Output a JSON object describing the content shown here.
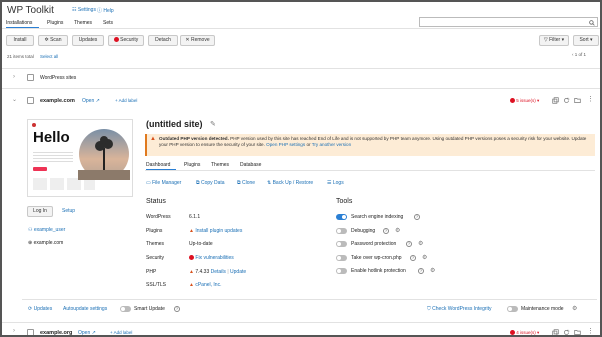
{
  "header": {
    "title": "WP Toolkit",
    "settings_label": "Settings",
    "help_label": "Help"
  },
  "tabs": [
    "Installations",
    "Plugins",
    "Themes",
    "Sets"
  ],
  "toolbar": {
    "install": "Install",
    "scan": "Scan",
    "updates": "Updates",
    "security": "Security",
    "detach": "Detach",
    "remove": "Remove",
    "filter": "Filter",
    "sort": "Sort",
    "search_value": ""
  },
  "summary": {
    "items_total": "21 items total",
    "select_all": "Select all",
    "pagination": "1 of 1"
  },
  "group": {
    "label": "WordPress sites"
  },
  "site1": {
    "domain": "example.com",
    "open": "Open",
    "add_label": "Add label",
    "issues": "5 issue(s)",
    "title": "(untitled site)",
    "alert_bold": "Outdated PHP version detected.",
    "alert_text": "PHP version used by this site has reached End of Life and is not supported by PHP team anymore. Using outdated PHP versions poses a security risk for your website. Update your PHP version to ensure the security of your site.",
    "alert_link1": "Open PHP settings",
    "alert_or": "or",
    "alert_link2": "Try another version",
    "inner_tabs": [
      "Dashboard",
      "Plugins",
      "Themes",
      "Database"
    ],
    "actions": [
      "File Manager",
      "Copy Data",
      "Clone",
      "Back Up / Restore",
      "Logs"
    ],
    "status_title": "Status",
    "status": [
      {
        "label": "WordPress",
        "value": "6.1.1"
      },
      {
        "label": "Plugins",
        "value": "Install plugin updates"
      },
      {
        "label": "Themes",
        "value": "Up-to-date"
      },
      {
        "label": "Security",
        "value": "Fix vulnerabilities"
      },
      {
        "label": "PHP",
        "value": "7.4.33",
        "link1": "Details",
        "link2": "Update"
      },
      {
        "label": "SSL/TLS",
        "value": "cPanel, Inc."
      }
    ],
    "tools_title": "Tools",
    "tools": [
      {
        "label": "Search engine indexing",
        "on": true
      },
      {
        "label": "Debugging",
        "on": false
      },
      {
        "label": "Password protection",
        "on": false
      },
      {
        "label": "Take over wp-cron.php",
        "on": false
      },
      {
        "label": "Enable hotlink protection",
        "on": false
      }
    ],
    "login": "Log In",
    "setup": "Setup",
    "user": "example_user",
    "host": "example.com",
    "preview_heading": "Hello",
    "footer": {
      "updates": "Updates",
      "autoupdate": "Autoupdate settings",
      "smart_update": "Smart Update",
      "integrity": "Check WordPress Integrity",
      "maintenance": "Maintenance mode"
    }
  },
  "site2": {
    "domain": "example.org",
    "open": "Open",
    "add_label": "Add label",
    "issues": "4 issue(s)"
  },
  "colors": {
    "accent": "#2a7fd4",
    "warning_bg": "#fdecd6",
    "danger": "#d12222"
  }
}
